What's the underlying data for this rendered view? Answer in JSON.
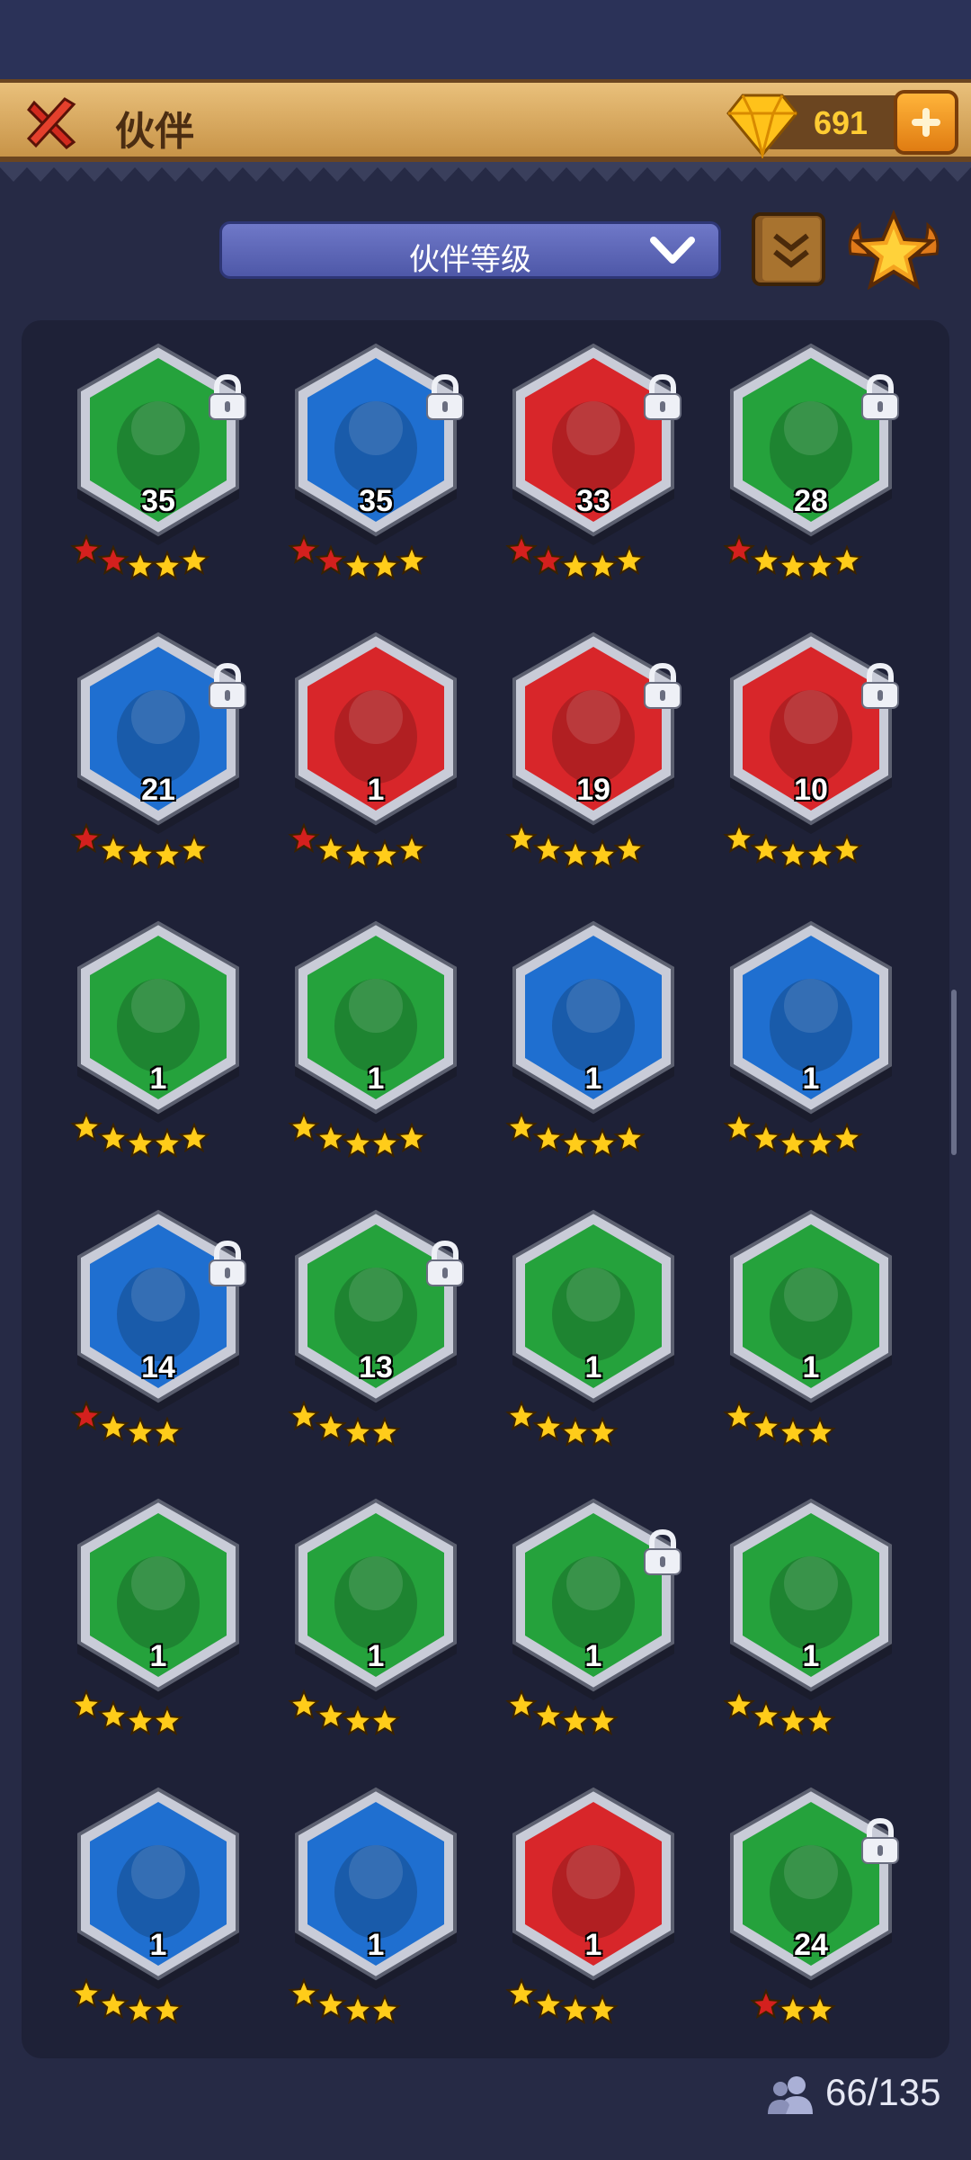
{
  "header": {
    "title": "伙伴",
    "gems": "691"
  },
  "filter": {
    "label": "伙伴等级"
  },
  "partners": [
    {
      "level": "35",
      "color": "green",
      "red_stars": 2,
      "yellow_stars": 3,
      "locked": true
    },
    {
      "level": "35",
      "color": "blue",
      "red_stars": 2,
      "yellow_stars": 3,
      "locked": true
    },
    {
      "level": "33",
      "color": "red",
      "red_stars": 2,
      "yellow_stars": 3,
      "locked": true
    },
    {
      "level": "28",
      "color": "green",
      "red_stars": 1,
      "yellow_stars": 4,
      "locked": true
    },
    {
      "level": "21",
      "color": "blue",
      "red_stars": 1,
      "yellow_stars": 4,
      "locked": true
    },
    {
      "level": "1",
      "color": "red",
      "red_stars": 1,
      "yellow_stars": 4,
      "locked": false
    },
    {
      "level": "19",
      "color": "red",
      "red_stars": 0,
      "yellow_stars": 5,
      "locked": true
    },
    {
      "level": "10",
      "color": "red",
      "red_stars": 0,
      "yellow_stars": 5,
      "locked": true
    },
    {
      "level": "1",
      "color": "green",
      "red_stars": 0,
      "yellow_stars": 5,
      "locked": false
    },
    {
      "level": "1",
      "color": "green",
      "red_stars": 0,
      "yellow_stars": 5,
      "locked": false
    },
    {
      "level": "1",
      "color": "blue",
      "red_stars": 0,
      "yellow_stars": 5,
      "locked": false
    },
    {
      "level": "1",
      "color": "blue",
      "red_stars": 0,
      "yellow_stars": 5,
      "locked": false
    },
    {
      "level": "14",
      "color": "blue",
      "red_stars": 1,
      "yellow_stars": 3,
      "locked": true
    },
    {
      "level": "13",
      "color": "green",
      "red_stars": 0,
      "yellow_stars": 4,
      "locked": true
    },
    {
      "level": "1",
      "color": "green",
      "red_stars": 0,
      "yellow_stars": 4,
      "locked": false
    },
    {
      "level": "1",
      "color": "green",
      "red_stars": 0,
      "yellow_stars": 4,
      "locked": false
    },
    {
      "level": "1",
      "color": "green",
      "red_stars": 0,
      "yellow_stars": 4,
      "locked": false
    },
    {
      "level": "1",
      "color": "green",
      "red_stars": 0,
      "yellow_stars": 4,
      "locked": false
    },
    {
      "level": "1",
      "color": "green",
      "red_stars": 0,
      "yellow_stars": 4,
      "locked": true
    },
    {
      "level": "1",
      "color": "green",
      "red_stars": 0,
      "yellow_stars": 4,
      "locked": false
    },
    {
      "level": "1",
      "color": "blue",
      "red_stars": 0,
      "yellow_stars": 4,
      "locked": false
    },
    {
      "level": "1",
      "color": "blue",
      "red_stars": 0,
      "yellow_stars": 4,
      "locked": false
    },
    {
      "level": "1",
      "color": "red",
      "red_stars": 0,
      "yellow_stars": 4,
      "locked": false
    },
    {
      "level": "24",
      "color": "green",
      "red_stars": 1,
      "yellow_stars": 2,
      "locked": true
    }
  ],
  "palette": {
    "green": "#25a23c",
    "blue": "#1f6fd0",
    "red": "#d8262a",
    "gold": "#ffcc1a",
    "red_star": "#d4201e"
  },
  "footer": {
    "count": "66/135"
  }
}
